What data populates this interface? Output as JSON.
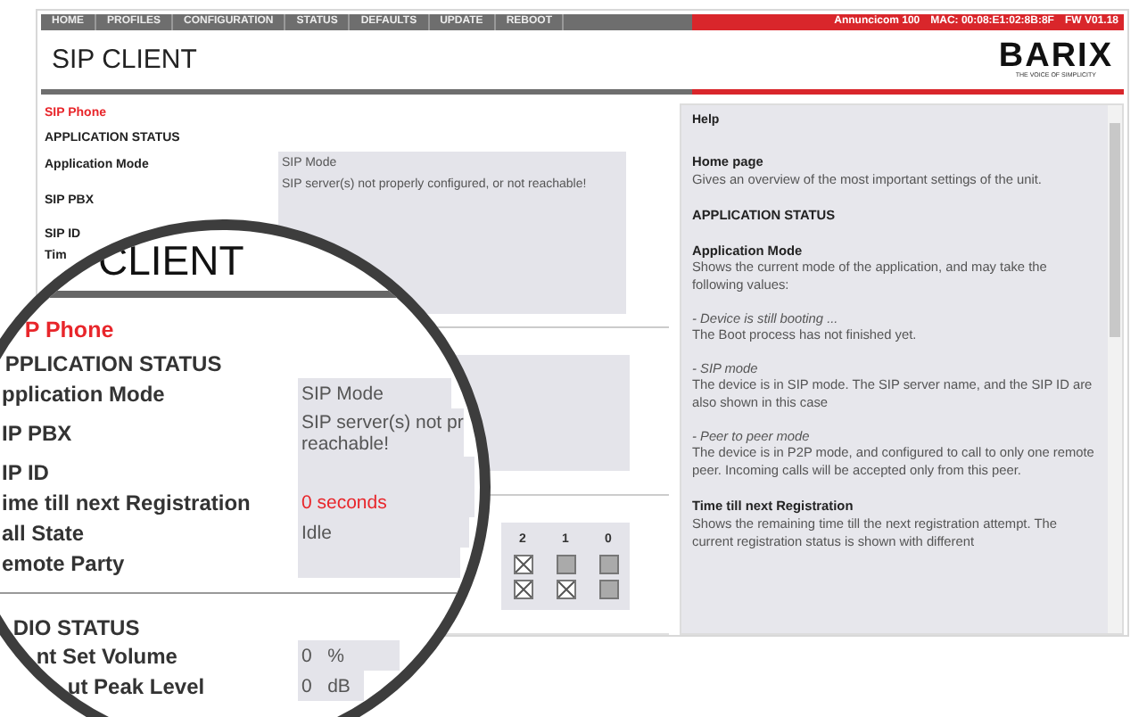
{
  "nav": {
    "items": [
      "HOME",
      "PROFILES",
      "CONFIGURATION",
      "STATUS",
      "DEFAULTS",
      "UPDATE",
      "REBOOT"
    ],
    "device_info": [
      "Annuncicom 100",
      "MAC: 00:08:E1:02:8B:8F",
      "FW V01.18"
    ]
  },
  "header": {
    "title": "SIP CLIENT",
    "logo": "BARIX",
    "tagline": "THE VOICE OF SIMPLICITY"
  },
  "status_panel": {
    "section": "SIP Phone",
    "heading": "APPLICATION STATUS",
    "labels": [
      "Application Mode",
      "SIP PBX",
      "SIP ID",
      "Tim"
    ],
    "values": [
      "SIP Mode",
      "SIP server(s) not properly configured, or not reachable!"
    ],
    "checkbox_grid": {
      "columns": [
        "2",
        "1",
        "0"
      ],
      "rows": [
        [
          {
            "checked": true
          },
          {
            "checked": false
          },
          {
            "checked": false
          }
        ],
        [
          {
            "checked": true
          },
          {
            "checked": true
          },
          {
            "checked": false
          }
        ]
      ]
    }
  },
  "magnifier": {
    "title": "CLIENT",
    "section": "P Phone",
    "rows": [
      {
        "kind": "heading",
        "label": "PPLICATION STATUS"
      },
      {
        "kind": "field",
        "label": "pplication Mode",
        "value_lines": [
          "SIP Mode"
        ],
        "alert": false
      },
      {
        "kind": "field",
        "label": "IP PBX",
        "value_lines": [
          "SIP server(s) not pr",
          "reachable!"
        ],
        "alert": false
      },
      {
        "kind": "field",
        "label": "IP ID"
      },
      {
        "kind": "field",
        "label": "ime till next Registration",
        "value_lines": [
          "0 seconds"
        ],
        "alert": true
      },
      {
        "kind": "field",
        "label": "all State",
        "value_lines": [
          "Idle"
        ],
        "alert": false
      },
      {
        "kind": "field",
        "label": "emote Party"
      },
      {
        "kind": "heading",
        "label": "DIO STATUS"
      },
      {
        "kind": "field",
        "label": "nt Set Volume",
        "value_lines": [
          "0   %"
        ],
        "alert": false
      },
      {
        "kind": "field",
        "label": "ut Peak Level",
        "value_lines": [
          "0   dB"
        ],
        "alert": false
      }
    ]
  },
  "help": {
    "title": "Help",
    "blocks": [
      {
        "kind": "heading",
        "text": "Home page"
      },
      {
        "kind": "text",
        "text": "Gives an overview of the most important settings of the unit."
      },
      {
        "kind": "heading",
        "text": "APPLICATION STATUS"
      },
      {
        "kind": "heading",
        "text": "Application Mode"
      },
      {
        "kind": "text",
        "text": "Shows the current mode of the application, and may take the following values:"
      },
      {
        "kind": "option",
        "text": "- Device is still booting ..."
      },
      {
        "kind": "text",
        "text": "The Boot process has not finished yet."
      },
      {
        "kind": "option",
        "text": "- SIP mode"
      },
      {
        "kind": "text",
        "text": "The device is in SIP mode. The SIP server name, and the SIP ID are also shown in this case"
      },
      {
        "kind": "option",
        "text": "- Peer to peer mode"
      },
      {
        "kind": "text",
        "text": "The device is in P2P mode, and configured to call to only one remote peer. Incoming calls will be accepted only from this peer."
      },
      {
        "kind": "heading",
        "text": "Time till next Registration"
      },
      {
        "kind": "text",
        "text": "Shows the remaining time till the next registration attempt. The current registration status is shown with different"
      }
    ]
  }
}
